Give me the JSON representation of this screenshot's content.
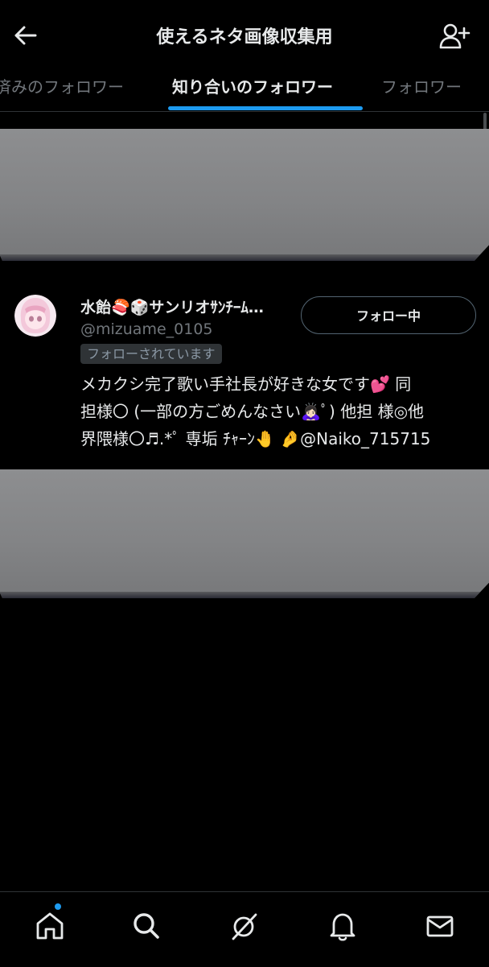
{
  "header": {
    "title": "使えるネタ画像収集用"
  },
  "tabs": [
    {
      "label": "済みのフォロワー"
    },
    {
      "label": "知り合いのフォロワー"
    },
    {
      "label": "フォロワー"
    }
  ],
  "user": {
    "name": "水飴🍣🎲サンリオｻﾝﾁｰﾑ…",
    "handle": "@mizuame_0105",
    "follows_you": "フォローされています",
    "follow_button": "フォロー中",
    "bio_lines": [
      "メカクシ完了歌い手社長が好きな女です💕 同",
      "担様〇 (一部の方ごめんなさい🙇🏻‍♀️ﾟ) 他担 様◎他",
      "界隈様〇♬.*ﾟ 専垢 ﾁｬｰﾝ🤚 🤌@Naiko_715715"
    ]
  },
  "colors": {
    "accent": "#1d9bf0",
    "background": "#000000",
    "text": "#e7e9ea",
    "muted": "#71767b"
  },
  "icons": [
    "back-arrow-icon",
    "add-user-icon",
    "home-icon",
    "search-icon",
    "grok-icon",
    "bell-icon",
    "mail-icon"
  ]
}
